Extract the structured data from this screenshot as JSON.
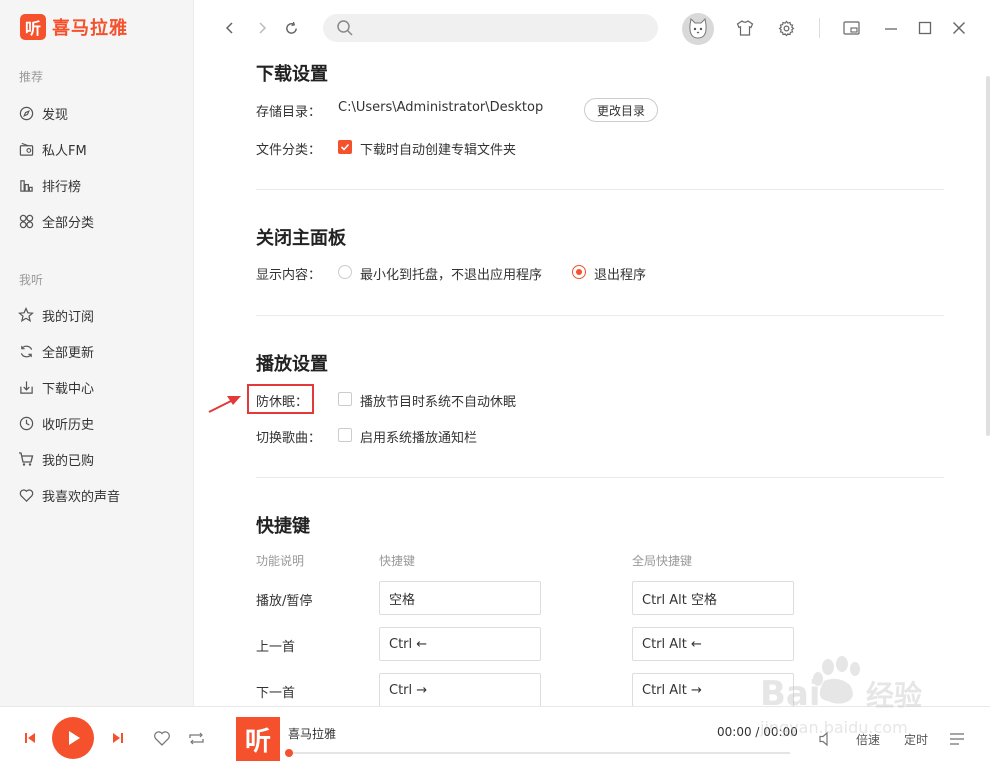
{
  "app": {
    "logo_glyph": "听",
    "name": "喜马拉雅",
    "accent": "#f4512c"
  },
  "sidebar": {
    "section1": "推荐",
    "items1": [
      {
        "label": "发现",
        "icon": "compass-icon"
      },
      {
        "label": "私人FM",
        "icon": "radio-icon"
      },
      {
        "label": "排行榜",
        "icon": "chart-icon"
      },
      {
        "label": "全部分类",
        "icon": "grid-icon"
      }
    ],
    "section2": "我听",
    "items2": [
      {
        "label": "我的订阅",
        "icon": "star-icon"
      },
      {
        "label": "全部更新",
        "icon": "refresh-icon"
      },
      {
        "label": "下载中心",
        "icon": "download-icon"
      },
      {
        "label": "收听历史",
        "icon": "clock-icon"
      },
      {
        "label": "我的已购",
        "icon": "cart-icon"
      },
      {
        "label": "我喜欢的声音",
        "icon": "heart-icon"
      }
    ]
  },
  "topbar": {
    "search_placeholder": "",
    "search_value": ""
  },
  "settings": {
    "download": {
      "heading": "下载设置",
      "dir_label": "存储目录：",
      "dir_value": "C:\\Users\\Administrator\\Desktop",
      "change_btn": "更改目录",
      "category_label": "文件分类：",
      "category_option": "下载时自动创建专辑文件夹",
      "category_checked": true
    },
    "close_panel": {
      "heading": "关闭主面板",
      "display_label": "显示内容：",
      "opt_minimize": "最小化到托盘，不退出应用程序",
      "opt_exit": "退出程序",
      "selected": "exit"
    },
    "playback": {
      "heading": "播放设置",
      "sleep_label": "防休眠：",
      "sleep_option": "播放节目时系统不自动休眠",
      "sleep_checked": false,
      "switch_label": "切换歌曲：",
      "switch_option": "启用系统播放通知栏",
      "switch_checked": false
    },
    "hotkeys": {
      "heading": "快捷键",
      "col_func": "功能说明",
      "col_key": "快捷键",
      "col_global": "全局快捷键",
      "rows": [
        {
          "func": "播放/暂停",
          "key": "空格",
          "global": "Ctrl Alt 空格"
        },
        {
          "func": "上一首",
          "key": "Ctrl ←",
          "global": "Ctrl Alt ←"
        },
        {
          "func": "下一首",
          "key": "Ctrl →",
          "global": "Ctrl Alt →"
        }
      ]
    }
  },
  "player": {
    "cover_glyph": "听",
    "title": "喜马拉雅",
    "time": "00:00 / 00:00",
    "progress": 0,
    "speed_label": "倍速",
    "timer_label": "定时"
  },
  "watermark": {
    "brand": "Bai 经验",
    "url": "jingyan.baidu.com"
  }
}
